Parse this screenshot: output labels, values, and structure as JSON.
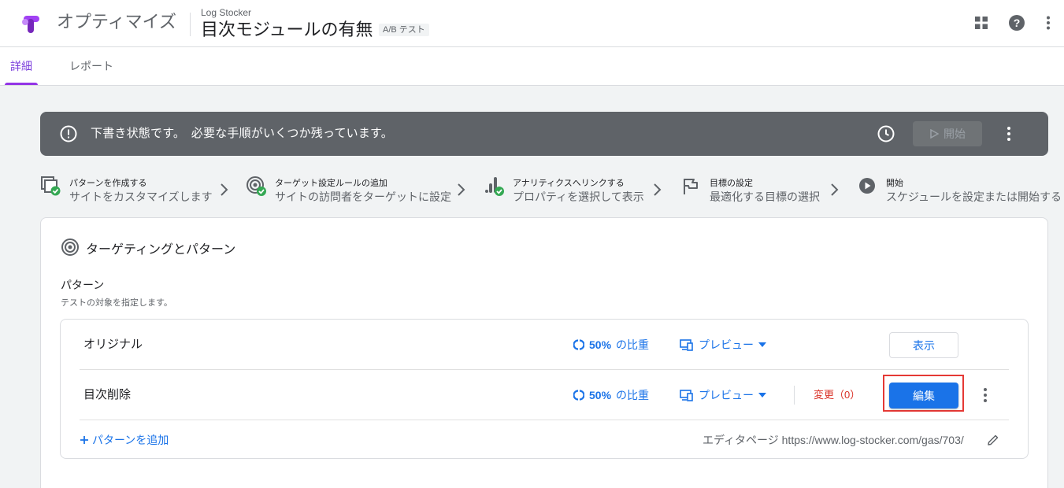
{
  "header": {
    "app_name": "オプティマイズ",
    "account": "Log Stocker",
    "experience_name": "目次モジュールの有無",
    "experience_type": "A/B テスト",
    "icons": [
      "apps-grid-icon",
      "help-icon",
      "more-vert-icon"
    ]
  },
  "tabs": [
    {
      "label": "詳細",
      "active": true
    },
    {
      "label": "レポート",
      "active": false
    }
  ],
  "banner": {
    "message": "下書き状態です。　必要な手順がいくつか残っています。",
    "start_label": "開始"
  },
  "steps": [
    {
      "title": "パターンを作成する",
      "subtitle": "サイトをカスタマイズします",
      "icon": "variants-check-icon"
    },
    {
      "title": "ターゲット設定ルールの追加",
      "subtitle": "サイトの訪問者をターゲットに設定",
      "icon": "target-check-icon"
    },
    {
      "title": "アナリティクスへリンクする",
      "subtitle": "プロパティを選択して表示",
      "icon": "analytics-check-icon"
    },
    {
      "title": "目標の設定",
      "subtitle": "最適化する目標の選択",
      "icon": "flag-icon"
    },
    {
      "title": "開始",
      "subtitle": "スケジュールを設定または開始する",
      "icon": "play-circle-icon"
    }
  ],
  "card": {
    "title": "ターゲティングとパターン",
    "section_label": "パターン",
    "section_desc": "テストの対象を指定します。",
    "variants": [
      {
        "name": "オリジナル",
        "weight": "50%",
        "weight_suffix": "の比重",
        "preview": "プレビュー",
        "action": "表示"
      },
      {
        "name": "目次削除",
        "weight": "50%",
        "weight_suffix": "の比重",
        "preview": "プレビュー",
        "changes": "変更（0）",
        "action": "編集"
      }
    ],
    "add_variant": "パターンを追加",
    "editor_page_label": "エディタページ",
    "editor_page_url": "https://www.log-stocker.com/gas/703/"
  },
  "colors": {
    "accent": "#1a73e8",
    "brand": "#9334e6",
    "banner_bg": "#5f6368",
    "success": "#34a853",
    "danger": "#d93025",
    "highlight": "#e53935"
  }
}
